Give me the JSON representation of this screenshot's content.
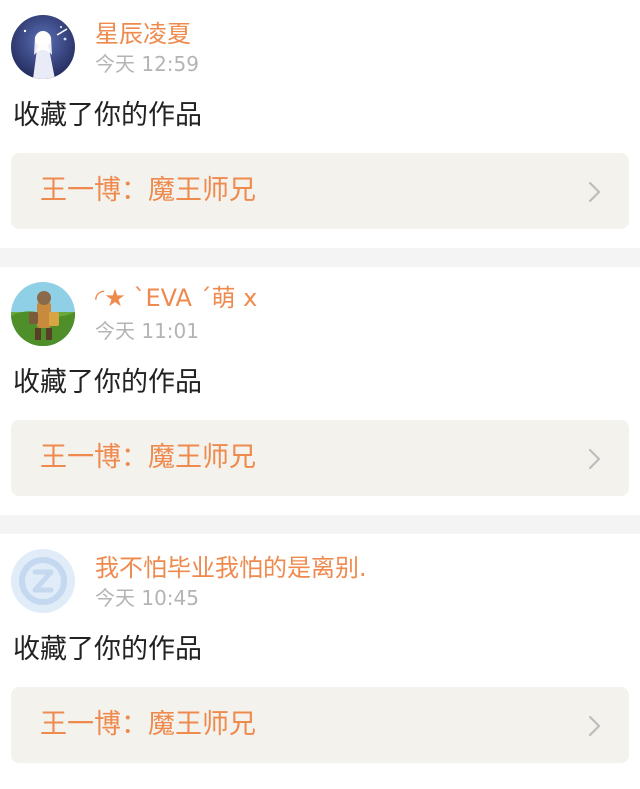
{
  "notifications": [
    {
      "username": "星辰凌夏",
      "time": "今天 12:59",
      "action": "收藏了你的作品",
      "work_title": "王一博：魔王师兄"
    },
    {
      "username": "◜★ ˋEVA ˊ萌 x",
      "time": "今天 11:01",
      "action": "收藏了你的作品",
      "work_title": "王一博：魔王师兄"
    },
    {
      "username": "我不怕毕业我怕的是离别.",
      "time": "今天 10:45",
      "action": "收藏了你的作品",
      "work_title": "王一博：魔王师兄"
    }
  ],
  "colors": {
    "accent": "#ef8a4e",
    "muted": "#b4b4b4",
    "text": "#222222",
    "panel": "#f3f2ed",
    "divider": "#f4f4f4"
  },
  "icons": {
    "avatar_1": "anime-figure-avatar",
    "avatar_2": "cartoon-landscape-avatar",
    "avatar_3": "default-qq-avatar",
    "chevron": "chevron-right-icon"
  }
}
